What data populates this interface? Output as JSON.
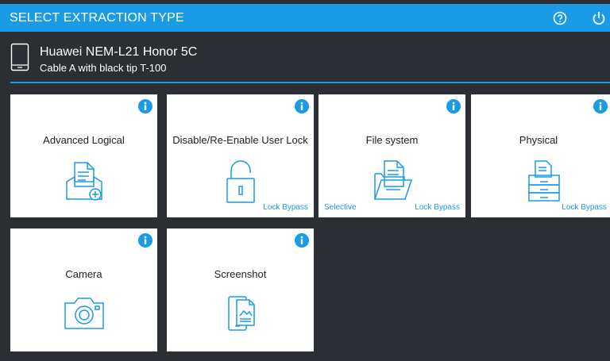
{
  "header": {
    "title": "SELECT EXTRACTION TYPE"
  },
  "device": {
    "name": "Huawei NEM-L21 Honor 5C",
    "cable": "Cable A with black tip T-100"
  },
  "tiles": [
    {
      "label": "Advanced Logical",
      "icon": "document-add-icon"
    },
    {
      "label": "Disable/Re-Enable User Lock",
      "icon": "padlock-icon",
      "tag_right": "Lock Bypass"
    },
    {
      "label": "File system",
      "icon": "folder-document-icon",
      "tag_left": "Selective",
      "tag_right": "Lock Bypass"
    },
    {
      "label": "Physical",
      "icon": "drawer-cabinet-icon",
      "tag_right": "Lock Bypass"
    },
    {
      "label": "Camera",
      "icon": "camera-icon"
    },
    {
      "label": "Screenshot",
      "icon": "screenshot-icon"
    }
  ],
  "colors": {
    "accent": "#1a9be8",
    "background": "#2b2f33",
    "tile": "#ffffff"
  }
}
